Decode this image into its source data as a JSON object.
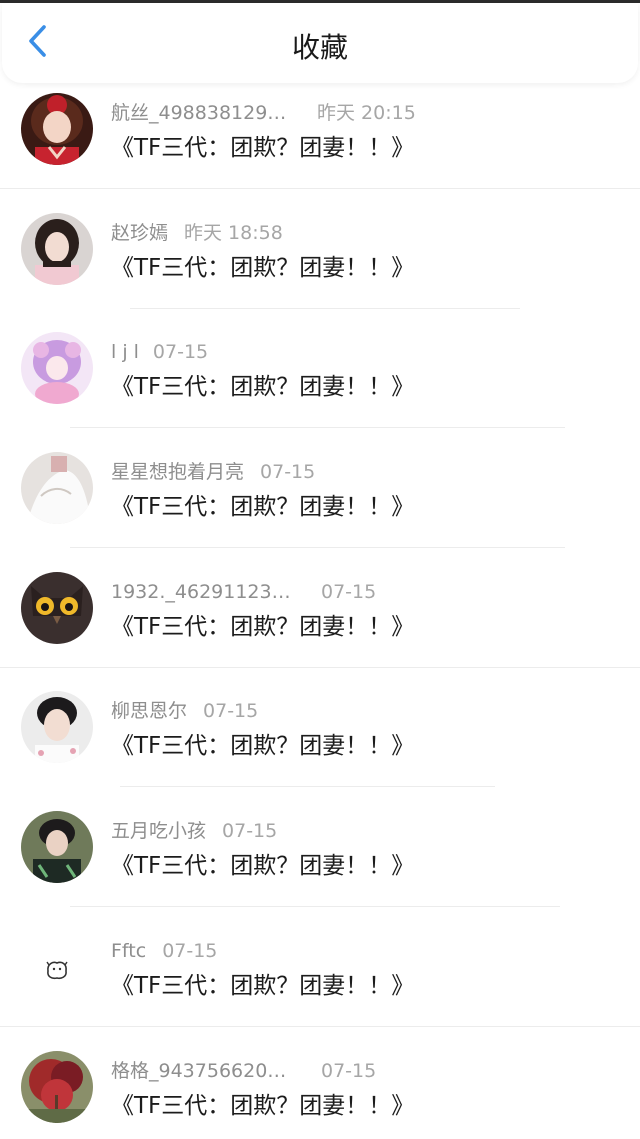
{
  "header": {
    "title": "收藏",
    "back_icon": "chevron-left-icon",
    "accent_color": "#3a8ee6"
  },
  "items": [
    {
      "name": "航丝_498838129…",
      "time": "昨天 20:15",
      "title": "《TF三代：团欺？团妻！！》",
      "avatar": "girl-red-dress-avatar"
    },
    {
      "name": "赵珍嫣",
      "time": "昨天 18:58",
      "title": "《TF三代：团欺？团妻！！》",
      "avatar": "girl-pink-avatar"
    },
    {
      "name": "l j l",
      "time": "07-15",
      "title": "《TF三代：团欺？团妻！！》",
      "avatar": "anime-girl-avatar"
    },
    {
      "name": "星星想抱着月亮",
      "time": "07-15",
      "title": "《TF三代：团欺？团妻！！》",
      "avatar": "white-cloth-avatar"
    },
    {
      "name": "1932._46291123…",
      "time": "07-15",
      "title": "《TF三代：团欺？团妻！！》",
      "avatar": "owl-avatar"
    },
    {
      "name": "柳思恩尔",
      "time": "07-15",
      "title": "《TF三代：团欺？团妻！！》",
      "avatar": "boy-portrait-avatar"
    },
    {
      "name": "五月吃小孩",
      "time": "07-15",
      "title": "《TF三代：团欺？团妻！！》",
      "avatar": "boy-jacket-avatar"
    },
    {
      "name": "Fftc",
      "time": "07-15",
      "title": "《TF三代：团欺？团妻！！》",
      "avatar": "doodle-animal-avatar"
    },
    {
      "name": "格格_943756620…",
      "time": "07-15",
      "title": "《TF三代：团欺？团妻！！》",
      "avatar": "red-leaves-avatar"
    }
  ]
}
